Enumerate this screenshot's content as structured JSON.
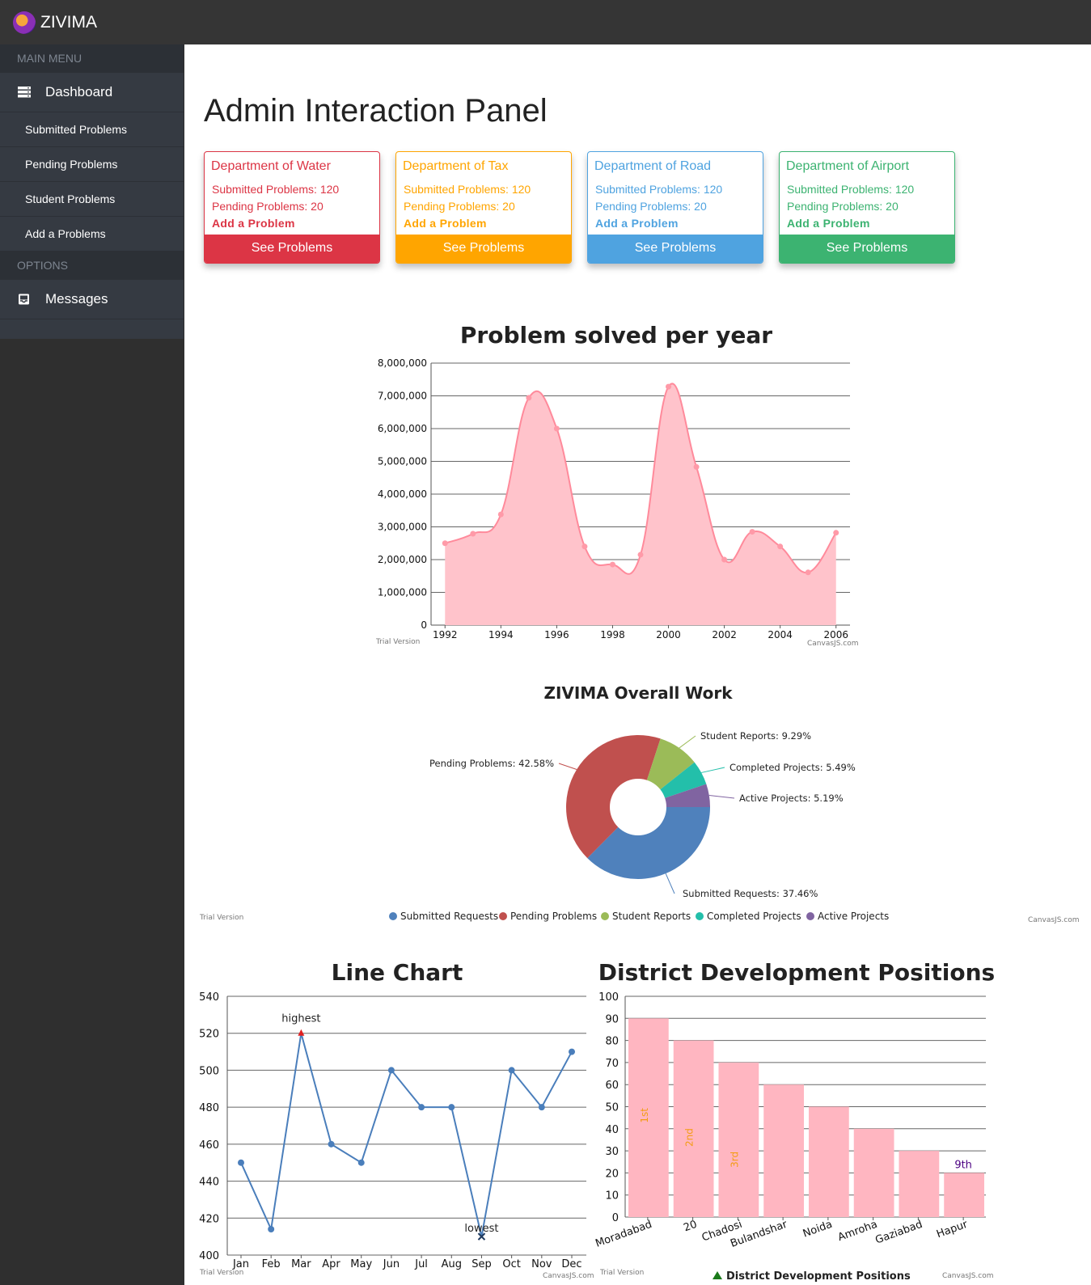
{
  "app": {
    "name": "ZIVIMA"
  },
  "sidebar": {
    "main_menu_label": "MAIN MENU",
    "dashboard_label": "Dashboard",
    "items": [
      {
        "label": "Submitted Problems"
      },
      {
        "label": "Pending Problems"
      },
      {
        "label": "Student Problems"
      },
      {
        "label": "Add a Problems"
      }
    ],
    "options_label": "OPTIONS",
    "messages_label": "Messages"
  },
  "main": {
    "title": "Admin Interaction Panel"
  },
  "cards": [
    {
      "title": "Department of Water",
      "submitted": "Submitted Problems: 120",
      "pending": "Pending Problems: 20",
      "add": "Add a Problem",
      "button": "See Problems",
      "color": "#dc3545"
    },
    {
      "title": "Department of Tax",
      "submitted": "Submitted Problems: 120",
      "pending": "Pending Problems: 20",
      "add": "Add a Problem",
      "button": "See Problems",
      "color": "#ffa500"
    },
    {
      "title": "Department of Road",
      "submitted": "Submitted Problems: 120",
      "pending": "Pending Problems: 20",
      "add": "Add a Problem",
      "button": "See Problems",
      "color": "#4fa3e0"
    },
    {
      "title": "Department of Airport",
      "submitted": "Submitted Problems: 120",
      "pending": "Pending Problems: 20",
      "add": "Add a Problem",
      "button": "See Problems",
      "color": "#3cb371"
    }
  ],
  "canvas_notes": {
    "trial": "Trial Version",
    "credit": "CanvasJS.com"
  },
  "chart_data": [
    {
      "type": "area",
      "title": "Problem solved per year",
      "x": [
        1992,
        1993,
        1994,
        1995,
        1996,
        1997,
        1998,
        1999,
        2000,
        2001,
        2002,
        2003,
        2004,
        2005,
        2006
      ],
      "values": [
        2500000,
        2790000,
        3380000,
        6940000,
        6000000,
        2400000,
        1850000,
        2150000,
        7280000,
        4830000,
        2000000,
        2850000,
        2400000,
        1610000,
        2820000
      ],
      "ylim": [
        0,
        8000000
      ],
      "yticks": [
        "0",
        "1,000,000",
        "2,000,000",
        "3,000,000",
        "4,000,000",
        "5,000,000",
        "6,000,000",
        "7,000,000",
        "8,000,000"
      ],
      "xticks": [
        "1992",
        "1994",
        "1996",
        "1998",
        "2000",
        "2002",
        "2004",
        "2006"
      ],
      "color": "#ff8a9b"
    },
    {
      "type": "pie",
      "title": "ZIVIMA Overall Work",
      "labels": [
        "Submitted Requests",
        "Pending Problems",
        "Student Reports",
        "Completed Projects",
        "Active Projects"
      ],
      "values": [
        37.46,
        42.58,
        9.29,
        5.49,
        5.19
      ],
      "display": [
        "Submitted Requests: 37.46%",
        "Pending Problems: 42.58%",
        "Student Reports: 9.29%",
        "Completed Projects: 5.49%",
        "Active Projects: 5.19%"
      ],
      "colors": [
        "#4f81bc",
        "#c0504e",
        "#9bbb58",
        "#23bfaa",
        "#8064a1"
      ]
    },
    {
      "type": "line",
      "title": "Line Chart",
      "categories": [
        "Jan",
        "Feb",
        "Mar",
        "Apr",
        "May",
        "Jun",
        "Jul",
        "Aug",
        "Sep",
        "Oct",
        "Nov",
        "Dec"
      ],
      "values": [
        450,
        414,
        520,
        460,
        450,
        500,
        480,
        480,
        410,
        500,
        480,
        510
      ],
      "ylim": [
        400,
        540
      ],
      "yticks": [
        "400",
        "420",
        "440",
        "460",
        "480",
        "500",
        "520",
        "540"
      ],
      "annotations": [
        {
          "index": 2,
          "text": "highest"
        },
        {
          "index": 8,
          "text": "lowest"
        }
      ],
      "color": "#4a7ebb"
    },
    {
      "type": "bar",
      "title": "District Development Positions",
      "categories": [
        "Moradabad",
        "20",
        "Chadosi",
        "Bulandshar",
        "Noida",
        "Amroha",
        "Gaziabad",
        "Hapur"
      ],
      "values": [
        90,
        80,
        70,
        60,
        50,
        40,
        30,
        20
      ],
      "bar_labels": [
        "1st",
        "2nd",
        "3rd",
        "",
        "",
        "",
        "",
        "9th"
      ],
      "ylim": [
        0,
        100
      ],
      "yticks": [
        "0",
        "10",
        "20",
        "30",
        "40",
        "50",
        "60",
        "70",
        "80",
        "90",
        "100"
      ],
      "legend": "District Development Positions",
      "color": "#ffb6c1"
    }
  ]
}
